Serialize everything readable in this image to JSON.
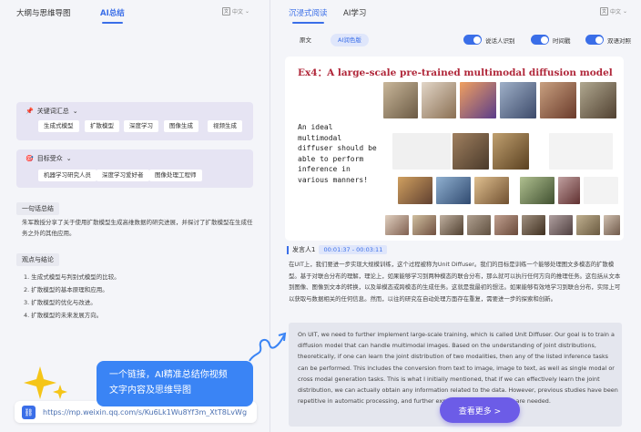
{
  "left": {
    "tabs": [
      {
        "label": "大纲与思维导图"
      },
      {
        "label": "AI总结"
      }
    ],
    "lang": "中文",
    "keywords": {
      "title": "关键词汇总",
      "items": [
        "生成式模型",
        "扩散模型",
        "深度学习",
        "图像生成",
        "视频生成"
      ]
    },
    "audience": {
      "title": "目标受众",
      "items": [
        "机器学习研究人员",
        "深度学习爱好者",
        "图像处理工程师"
      ]
    },
    "summary": {
      "title": "一句话总结",
      "text": "朱军教授分享了关于使用扩散模型生成高维数据的研究进展，并探讨了扩散模型在生成任务之外的其他应用。"
    },
    "viewpoints": {
      "title": "观点与结论",
      "items": [
        "1. 生成式模型与判别式模型的比较。",
        "2. 扩散模型的基本原理和应用。",
        "3. 扩散模型的优化与改进。",
        "4. 扩散模型的未来发展方向。"
      ]
    },
    "promo": {
      "line1": "一个链接，AI精准总结你视频",
      "line2": "文字内容及思维导图"
    },
    "url": "https://mp.weixin.qq.com/s/Ku6Lk1Wu8Yf3m_XtT8LvWg"
  },
  "right": {
    "tabs": [
      {
        "label": "沉浸式阅读"
      },
      {
        "label": "AI学习"
      }
    ],
    "lang": "中文",
    "modes": [
      "原文",
      "AI润色版"
    ],
    "toggles": [
      "说话人识别",
      "时间戳",
      "双语对照"
    ],
    "slide": {
      "title": "Ex4：A large-scale pre-trained multimodal diffusion model",
      "quote": "An ideal multimodal diffuser should be able to perform inference in various manners!"
    },
    "speaker": {
      "name": "发言人1",
      "time": "00:01:37 - 00:03:11"
    },
    "cn_text": "在UIT上，我们要进一步实现大规模训练，这个过程被称为Unit Diffuser。我们的目标是训练一个能够处理图文多模态的扩散模型。基于对联合分布的理解，理论上，如果能够学习到两种模态的联合分布，那么就可以执行任何方向的推理任务。这包括从文本到图像、图像到文本的转换，以及单模态或跨模态的生成任务。这就是我最初的想法。如果能够有效地学习到联合分布，实际上可以获取与数据相关的任何信息。然而，以往的研究在自动处理方面存在重复，需要进一步的探索和创新。",
    "en_text": "On UIT, we need to further implement large-scale training, which is called Unit Diffuser. Our goal is to train a diffusion model that can handle multimodal images. Based on the understanding of joint distributions, theoretically, if one can learn the joint distribution of two modalities, then any of the listed inference tasks can be performed. This includes the conversion from text to image, image to text, as well as single modal or cross modal generation tasks. This is what I initially mentioned, that if we can effectively learn the joint distribution, we can actually obtain any information related to the data. However, previous studies have been repetitive in automatic processing, and further exploration and innovation are needed.",
    "more_label": "查看更多 >"
  },
  "colors": {
    "accent": "#3a6ee8",
    "promo": "#3a84f5",
    "more": "#6c5ce7",
    "card": "#e6e4f3"
  }
}
